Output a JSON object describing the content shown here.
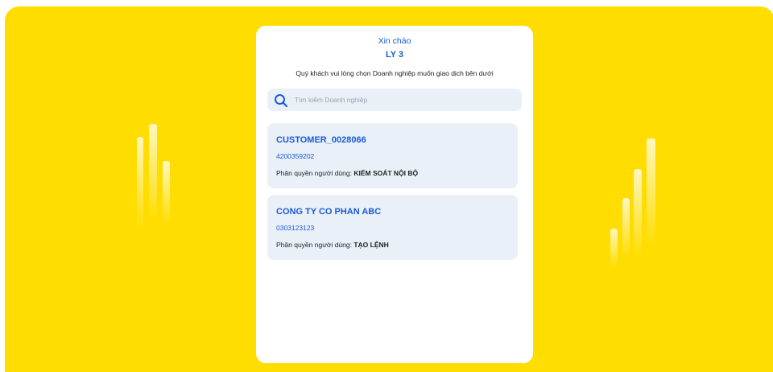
{
  "greeting": "Xin chào",
  "username": "LY 3",
  "instruction": "Quý khách vui lòng chọn Doanh nghiệp muốn giao dịch bên dưới",
  "search": {
    "placeholder": "Tìm kiếm Doanh nghiệp",
    "icon": "search-icon"
  },
  "role_label": "Phân quyền người dùng:",
  "companies": [
    {
      "name": "CUSTOMER_0028066",
      "tax_code": "4200359202",
      "role": "KIỂM SOÁT NỘI BỘ"
    },
    {
      "name": "CONG TY CO PHAN ABC",
      "tax_code": "0303123123",
      "role": "TẠO LỆNH"
    }
  ],
  "colors": {
    "background": "#FFDD00",
    "accent": "#1A5AD7",
    "card": "#FFFFFF",
    "item_background": "#EAF0F8"
  }
}
